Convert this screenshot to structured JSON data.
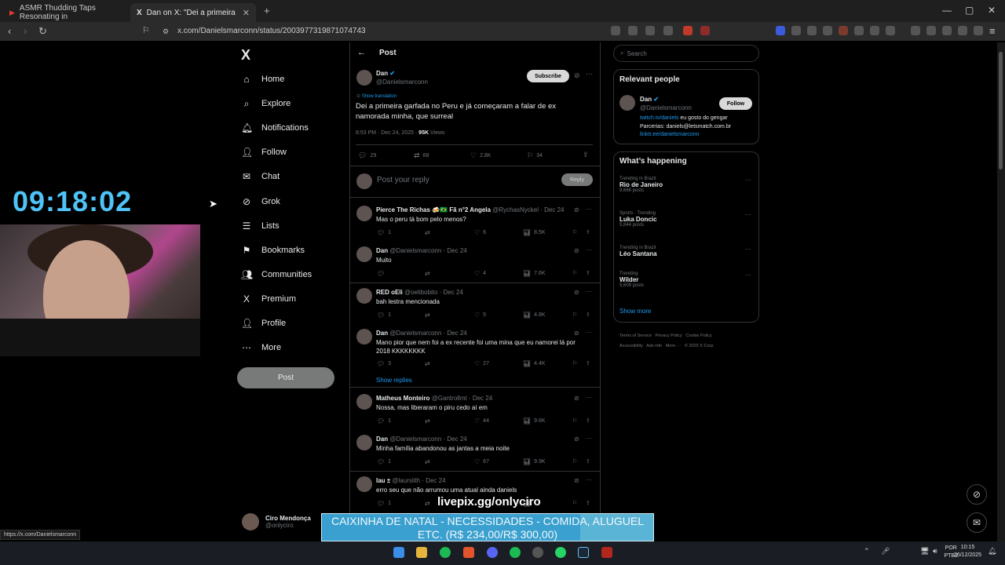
{
  "browser": {
    "tabs": [
      {
        "title": "ASMR Thudding Taps Resonating in",
        "active": false
      },
      {
        "title": "Dan on X: \"Dei a primeira garfad",
        "active": true
      }
    ],
    "url": "x.com/Danielsmarconn/status/2003977319871074743",
    "status_url": "https://x.com/Danielsmarconn"
  },
  "stream": {
    "clock": "09:18:02",
    "livepix": "livepix.gg/onlyciro",
    "donation_line1": "CAIXINHA DE NATAL - NECESSIDADES - COMIDA, ALUGUEL",
    "donation_line2": "ETC. (R$ 234,00/R$ 300,00)",
    "donation_progress": 0.78
  },
  "nav": {
    "logo": "X",
    "items": [
      {
        "label": "Home",
        "icon": "home-icon",
        "glyph": "⌂"
      },
      {
        "label": "Explore",
        "icon": "search-icon",
        "glyph": "⌕"
      },
      {
        "label": "Notifications",
        "icon": "bell-icon",
        "glyph": "🔔︎"
      },
      {
        "label": "Follow",
        "icon": "person-add-icon",
        "glyph": "👤︎"
      },
      {
        "label": "Chat",
        "icon": "mail-icon",
        "glyph": "✉"
      },
      {
        "label": "Grok",
        "icon": "grok-icon",
        "glyph": "⊘"
      },
      {
        "label": "Lists",
        "icon": "list-icon",
        "glyph": "☰"
      },
      {
        "label": "Bookmarks",
        "icon": "bookmark-icon",
        "glyph": "⚑"
      },
      {
        "label": "Communities",
        "icon": "communities-icon",
        "glyph": "👥︎"
      },
      {
        "label": "Premium",
        "icon": "x-premium-icon",
        "glyph": "X"
      },
      {
        "label": "Profile",
        "icon": "profile-icon",
        "glyph": "👤︎"
      },
      {
        "label": "More",
        "icon": "more-circle-icon",
        "glyph": "⋯"
      }
    ],
    "post_button": "Post",
    "account_name": "Ciro Mendonça",
    "account_handle": "@onlyciro"
  },
  "post": {
    "header": "Post",
    "author": "Dan",
    "handle": "@Danielsmarconn",
    "subscribe": "Subscribe",
    "show_translation": "Show translation",
    "text": "Dei a primeira garfada no Peru e já começaram a falar de ex namorada minha, que surreal",
    "time": "8:53 PM · Dec 24, 2025 ·",
    "views_count": "95K",
    "views_label": "Views",
    "replies": "29",
    "reposts": "68",
    "likes": "2.8K",
    "bookmarks": "34",
    "reply_placeholder": "Post your reply",
    "reply_button": "Reply"
  },
  "replies": [
    {
      "name": "Pierce The Richas 🍻🇧🇷 Fã n°2 Angela",
      "handle": "@RychasNyckel · Dec 24",
      "text": "Mas o peru tá bom pelo menos?",
      "r": "1",
      "rt": "",
      "l": "6",
      "v": "8.5K"
    },
    {
      "name": "Dan",
      "handle": "@Danielsmarconn · Dec 24",
      "text": "Muito",
      "r": "",
      "rt": "",
      "l": "4",
      "v": "7.6K"
    },
    {
      "name": "RED oEli",
      "handle": "@oelibobito · Dec 24",
      "text": "bah lestra mencionada",
      "r": "1",
      "rt": "",
      "l": "5",
      "v": "4.8K"
    },
    {
      "name": "Dan",
      "handle": "@Danielsmarconn · Dec 24",
      "text": "Mano pior que nem foi a ex recente foi uma mina que eu namorei lá por 2018 KKKKKKKK",
      "r": "3",
      "rt": "",
      "l": "27",
      "v": "4.4K"
    },
    {
      "name": "Matheus Monteiro",
      "handle": "@Gantrollmt · Dec 24",
      "text": "Nossa, mas liberaram o piru cedo aí em",
      "r": "1",
      "rt": "",
      "l": "44",
      "v": "9.6K"
    },
    {
      "name": "Dan",
      "handle": "@Danielsmarconn · Dec 24",
      "text": "Minha família abandonou as jantas a meia noite",
      "r": "1",
      "rt": "",
      "l": "67",
      "v": "9.9K"
    },
    {
      "name": "lau ±",
      "handle": "@laurslith · Dec 24",
      "text": "erro seu que não arrumou uma atual ainda daniels",
      "r": "1",
      "rt": "",
      "l": "",
      "v": ""
    }
  ],
  "show_replies": "Show replies",
  "right": {
    "search_placeholder": "Search",
    "relevant_title": "Relevant people",
    "person_name": "Dan",
    "person_handle": "@Danielsmarconn",
    "follow": "Follow",
    "bio_link": "twitch.tv/daniels",
    "bio_rest": " eu gosto do gengar",
    "bio_line2": "Parcerias: daniels@letsmatch.com.br",
    "bio_link2": "linktr.ee/danielsmarconn",
    "happening_title": "What’s happening",
    "trends": [
      {
        "label": "Trending in Brazil",
        "name": "Rio de Janeiro",
        "count": "9,666 posts"
      },
      {
        "label": "Sports · Trending",
        "name": "Luka Doncic",
        "count": "5,844 posts"
      },
      {
        "label": "Trending in Brazil",
        "name": "Léo Santana",
        "count": ""
      },
      {
        "label": "Trending",
        "name": "Wilder",
        "count": "5,609 posts"
      }
    ],
    "show_more": "Show more",
    "footer_line1": "Terms of Service   Privacy Policy   Cookie Policy",
    "footer_line2": "Accessibility   Ads info   More ···   © 2025 X Corp."
  },
  "taskbar": {
    "lang1": "POR",
    "lang2": "PTB2",
    "time": "10:15",
    "date": "26/12/2025"
  }
}
